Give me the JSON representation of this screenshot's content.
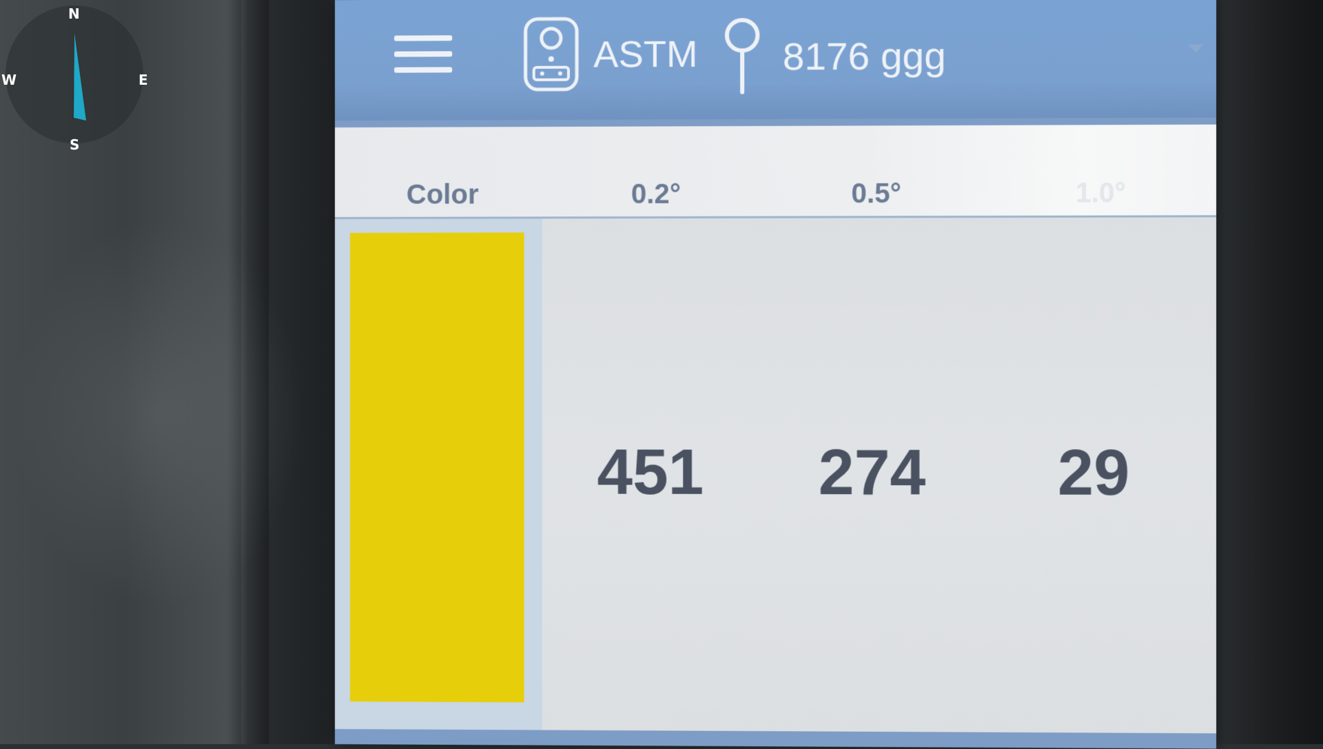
{
  "compass": {
    "north": "N",
    "south": "S",
    "west": "W",
    "east": "E",
    "needle_color": "#1fa8c8"
  },
  "header": {
    "menu_icon": "hamburger-menu-icon",
    "device_icon": "colorimeter-device-icon",
    "standard": "ASTM",
    "location_icon": "location-pin-icon",
    "sample_id": "8176 ggg",
    "accent_color": "#7aa3d3"
  },
  "table": {
    "columns": [
      "Color",
      "0.2°",
      "0.5°",
      "1.0°"
    ],
    "values": [
      "451",
      "274",
      "29"
    ],
    "swatch_color": "#e6cf0a"
  }
}
